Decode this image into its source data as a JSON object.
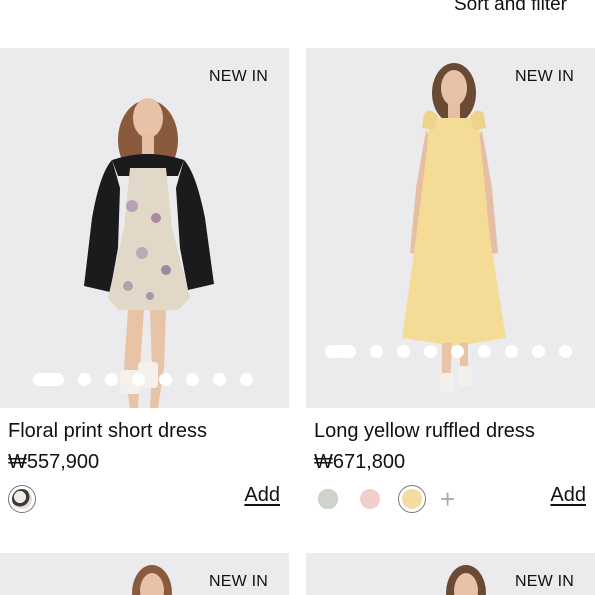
{
  "header": {
    "sort_filter_label": "Sort and filter"
  },
  "colors": {
    "photo_bg": "#ebebed",
    "swatch_border": "#777777"
  },
  "products": [
    {
      "badge": "NEW IN",
      "name": "Floral print short dress",
      "price": "₩557,900",
      "image_count": 8,
      "active_image": 1,
      "swatches": [
        "floral"
      ],
      "selected_swatch": 0,
      "more_colors": false,
      "add_label": "Add"
    },
    {
      "badge": "NEW IN",
      "name": "Long yellow ruffled dress",
      "price": "₩671,800",
      "image_count": 9,
      "active_image": 1,
      "swatches": [
        "sage",
        "pink",
        "yellow"
      ],
      "selected_swatch": 2,
      "more_colors": true,
      "add_label": "Add"
    },
    {
      "badge": "NEW IN"
    },
    {
      "badge": "NEW IN"
    }
  ]
}
